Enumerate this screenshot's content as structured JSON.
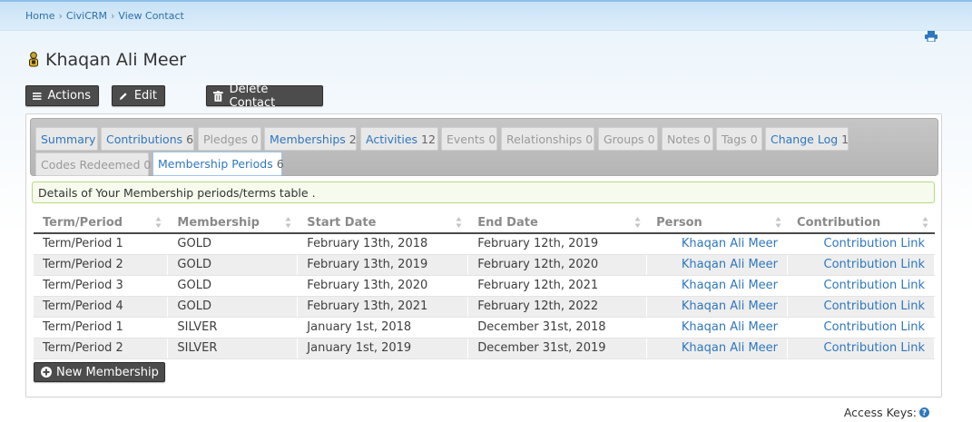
{
  "breadcrumb": [
    "Home",
    "CiviCRM",
    "View Contact"
  ],
  "contact": {
    "name": "Khaqan Ali Meer"
  },
  "actions": {
    "actions_label": "Actions",
    "edit_label": "Edit",
    "delete_label": "Delete Contact"
  },
  "tabs": [
    {
      "label": "Summary",
      "count": "",
      "enabled": true
    },
    {
      "label": "Contributions",
      "count": "6",
      "enabled": true
    },
    {
      "label": "Pledges",
      "count": "0",
      "enabled": false
    },
    {
      "label": "Memberships",
      "count": "2",
      "enabled": true
    },
    {
      "label": "Activities",
      "count": "12",
      "enabled": true
    },
    {
      "label": "Events",
      "count": "0",
      "enabled": false
    },
    {
      "label": "Relationships",
      "count": "0",
      "enabled": false
    },
    {
      "label": "Groups",
      "count": "0",
      "enabled": false
    },
    {
      "label": "Notes",
      "count": "0",
      "enabled": false
    },
    {
      "label": "Tags",
      "count": "0",
      "enabled": false
    },
    {
      "label": "Change Log",
      "count": "1",
      "enabled": true
    },
    {
      "label": "Codes Redeemed",
      "count": "0",
      "enabled": false
    },
    {
      "label": "Membership Periods",
      "count": "6",
      "enabled": true,
      "active": true
    }
  ],
  "notice": "Details of Your Membership periods/terms table .",
  "table": {
    "columns": [
      "Term/Period",
      "Membership",
      "Start Date",
      "End Date",
      "Person",
      "Contribution"
    ],
    "rows": [
      [
        "Term/Period 1",
        "GOLD",
        "February 13th, 2018",
        "February 12th, 2019",
        "Khaqan Ali Meer",
        "Contribution Link"
      ],
      [
        "Term/Period 2",
        "GOLD",
        "February 13th, 2019",
        "February 12th, 2020",
        "Khaqan Ali Meer",
        "Contribution Link"
      ],
      [
        "Term/Period 3",
        "GOLD",
        "February 13th, 2020",
        "February 12th, 2021",
        "Khaqan Ali Meer",
        "Contribution Link"
      ],
      [
        "Term/Period 4",
        "GOLD",
        "February 13th, 2021",
        "February 12th, 2022",
        "Khaqan Ali Meer",
        "Contribution Link"
      ],
      [
        "Term/Period 1",
        "SILVER",
        "January 1st, 2018",
        "December 31st, 2018",
        "Khaqan Ali Meer",
        "Contribution Link"
      ],
      [
        "Term/Period 2",
        "SILVER",
        "January 1st, 2019",
        "December 31st, 2019",
        "Khaqan Ali Meer",
        "Contribution Link"
      ]
    ]
  },
  "new_membership_label": "New Membership",
  "access_keys_label": "Access Keys:",
  "icons": {
    "print": "print-icon",
    "person": "person-icon",
    "menu": "hamburger-icon",
    "edit": "pencil-icon",
    "delete": "trash-icon",
    "add": "plus-circle-icon",
    "help": "help-icon"
  },
  "colors": {
    "link": "#2f77bd",
    "button": "#4c4c4c",
    "notice_border": "#b7d980"
  }
}
